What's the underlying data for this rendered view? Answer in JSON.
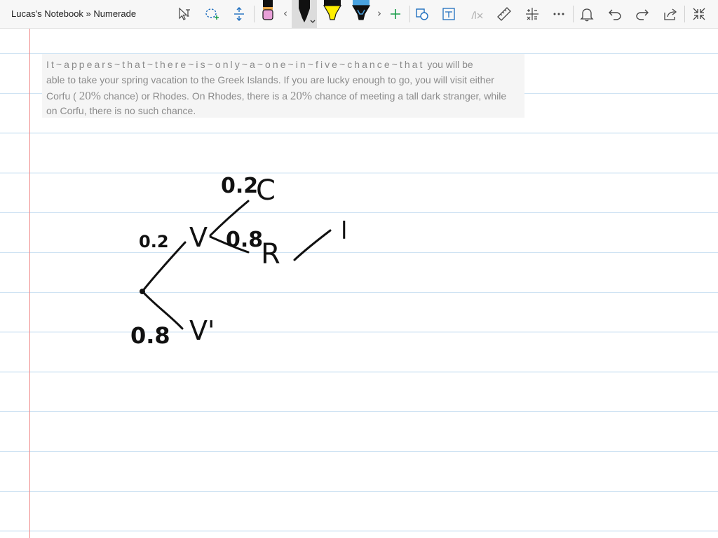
{
  "window": {
    "title": "Lucas's Notebook » Numerade"
  },
  "toolbar": {
    "tools": [
      {
        "name": "text-mode",
        "icon": "cursor-text-icon"
      },
      {
        "name": "lasso-select",
        "icon": "lasso-select-icon"
      },
      {
        "name": "add-space",
        "icon": "add-space-icon"
      },
      {
        "name": "pen-pink",
        "icon": "pen-icon",
        "color": "#e8a0d8"
      },
      {
        "name": "pen-black",
        "icon": "pen-icon",
        "color": "#111111",
        "selected": true
      },
      {
        "name": "highlighter-yellow",
        "icon": "highlighter-icon",
        "color": "#ffee00"
      },
      {
        "name": "highlighter-blue",
        "icon": "highlighter-icon",
        "color": "#4aa3e0"
      },
      {
        "name": "add-pen",
        "icon": "plus-icon"
      },
      {
        "name": "ink-to-shape",
        "icon": "ink-to-shape-icon"
      },
      {
        "name": "ink-to-text",
        "icon": "ink-to-text-icon"
      },
      {
        "name": "ink-to-math",
        "icon": "ink-to-math-icon"
      },
      {
        "name": "ruler",
        "icon": "ruler-icon"
      },
      {
        "name": "math",
        "icon": "math-icon"
      },
      {
        "name": "more",
        "icon": "more-icon"
      },
      {
        "name": "notifications",
        "icon": "bell-icon"
      },
      {
        "name": "undo",
        "icon": "undo-icon"
      },
      {
        "name": "redo",
        "icon": "redo-icon"
      },
      {
        "name": "share",
        "icon": "share-icon"
      },
      {
        "name": "full-screen",
        "icon": "collapse-icon"
      }
    ],
    "colors": {
      "accent_green": "#1a9e4a",
      "accent_blue": "#1f6fbf",
      "pen_black": "#111111",
      "highlighter_yellow": "#ffee00",
      "highlighter_blue": "#4aa3e0",
      "pen_pink": "#e8a0d8"
    }
  },
  "question": {
    "spaced_text": "It~appears~that~there~is~only~a~one~in~five~chance~that",
    "line1_rest": " you will be",
    "line2": "able to take your spring vacation to the Greek Islands. If you are lucky enough to go, you will visit either",
    "line3_a": "Corfu ( ",
    "math_1": "20%",
    "line3_b": " chance) or Rhodes. On Rhodes, there is a ",
    "math_2": "20%",
    "line3_c": " chance of meeting a tall dark stranger, while",
    "line4": "on Corfu, there is no such chance."
  },
  "handwriting": {
    "branch_v_prob": "0.2",
    "branch_v_prime_prob": "0.8",
    "node_v": "V",
    "node_v_prime": "V'",
    "branch_c_prob": "0.2",
    "node_c": "C",
    "branch_r_prob": "0.8",
    "node_r": "R",
    "partial_mark": "l",
    "ink_color": "#111111"
  },
  "notebook": {
    "margin_color": "#f08a8a",
    "rule_color": "#cfe3f3"
  }
}
